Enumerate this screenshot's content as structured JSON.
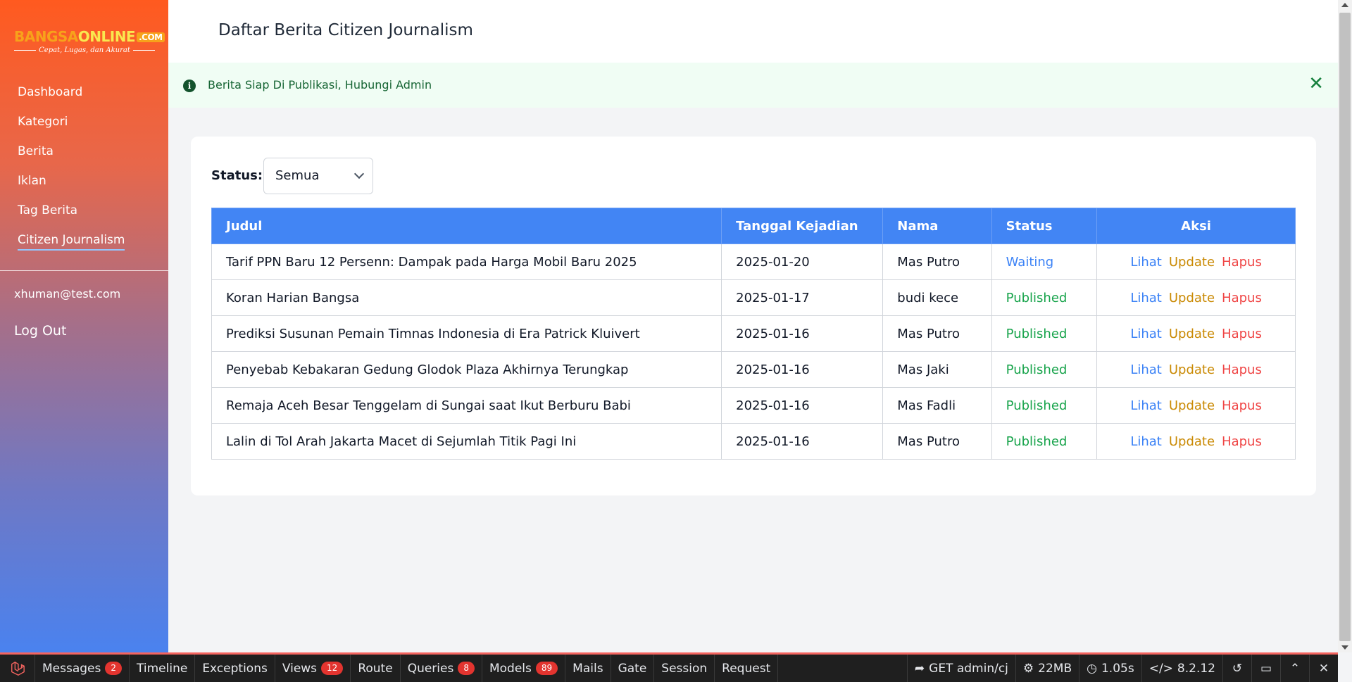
{
  "brand": {
    "part1": "BANGSA",
    "part2": "ONLINE",
    "suffix": ".COM",
    "tagline": "Cepat, Lugas, dan Akurat"
  },
  "sidebar": {
    "items": [
      {
        "label": "Dashboard"
      },
      {
        "label": "Kategori"
      },
      {
        "label": "Berita"
      },
      {
        "label": "Iklan"
      },
      {
        "label": "Tag Berita"
      },
      {
        "label": "Citizen Journalism",
        "active": true
      }
    ],
    "user_email": "xhuman@test.com",
    "logout_label": "Log Out"
  },
  "header": {
    "title": "Daftar Berita Citizen Journalism"
  },
  "alert": {
    "message": "Berita Siap Di Publikasi, Hubungi Admin",
    "close_glyph": "✕"
  },
  "filter": {
    "label": "Status:",
    "selected": "Semua"
  },
  "table": {
    "headers": [
      "Judul",
      "Tanggal Kejadian",
      "Nama",
      "Status",
      "Aksi"
    ],
    "action_labels": {
      "view": "Lihat",
      "update": "Update",
      "delete": "Hapus"
    },
    "rows": [
      {
        "title": "Tarif PPN Baru 12 Persenn: Dampak pada Harga Mobil Baru 2025",
        "date": "2025-01-20",
        "name": "Mas Putro",
        "status": "Waiting"
      },
      {
        "title": "Koran Harian Bangsa",
        "date": "2025-01-17",
        "name": "budi kece",
        "status": "Published"
      },
      {
        "title": "Prediksi Susunan Pemain Timnas Indonesia di Era Patrick Kluivert",
        "date": "2025-01-16",
        "name": "Mas Putro",
        "status": "Published"
      },
      {
        "title": "Penyebab Kebakaran Gedung Glodok Plaza Akhirnya Terungkap",
        "date": "2025-01-16",
        "name": "Mas Jaki",
        "status": "Published"
      },
      {
        "title": "Remaja Aceh Besar Tenggelam di Sungai saat Ikut Berburu Babi",
        "date": "2025-01-16",
        "name": "Mas Fadli",
        "status": "Published"
      },
      {
        "title": "Lalin di Tol Arah Jakarta Macet di Sejumlah Titik Pagi Ini",
        "date": "2025-01-16",
        "name": "Mas Putro",
        "status": "Published"
      }
    ]
  },
  "debugbar": {
    "tabs": [
      {
        "label": "Messages",
        "badge": "2"
      },
      {
        "label": "Timeline"
      },
      {
        "label": "Exceptions"
      },
      {
        "label": "Views",
        "badge": "12"
      },
      {
        "label": "Route"
      },
      {
        "label": "Queries",
        "badge": "8"
      },
      {
        "label": "Models",
        "badge": "89"
      },
      {
        "label": "Mails"
      },
      {
        "label": "Gate"
      },
      {
        "label": "Session"
      },
      {
        "label": "Request"
      }
    ],
    "request": "GET admin/cj",
    "memory": "22MB",
    "duration": "1.05s",
    "php_version": "8.2.12"
  },
  "colors": {
    "table_header": "#4285f4",
    "waiting": "#3b82f6",
    "published": "#16a34a",
    "view": "#3b82f6",
    "update": "#ca8a04",
    "delete": "#ef4444",
    "debug_accent": "#f4645f"
  },
  "icons": {
    "alert": "info-icon",
    "close": "close-icon",
    "select": "chevron-down-icon",
    "debug_logo": "laravel-icon",
    "request": "share-arrow-icon",
    "memory": "cogs-icon",
    "duration": "clock-icon",
    "php": "code-icon",
    "history": "history-icon",
    "open": "folder-open-icon",
    "minimize": "chevron-up-icon",
    "close_debug": "close-icon"
  }
}
